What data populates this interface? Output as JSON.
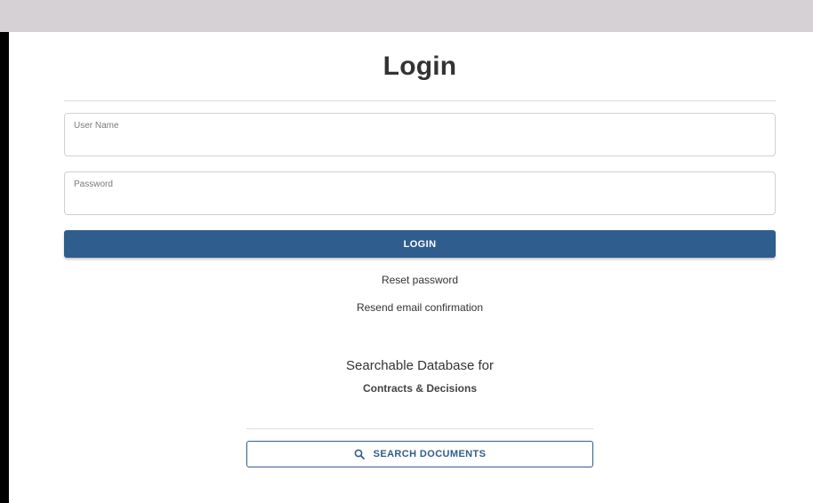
{
  "title": "Login",
  "form": {
    "username": {
      "label": "User Name",
      "value": ""
    },
    "password": {
      "label": "Password",
      "value": ""
    },
    "login_label": "LOGIN"
  },
  "links": {
    "reset_password": "Reset password",
    "resend_confirmation": "Resend email confirmation"
  },
  "tagline": {
    "line1": "Searchable Database for",
    "line2": "Contracts & Decisions"
  },
  "search": {
    "label": "SEARCH DOCUMENTS",
    "icon": "search-icon"
  },
  "colors": {
    "primary": "#2f5d8e",
    "top_bar": "#d5d1d5",
    "text": "#333333"
  }
}
